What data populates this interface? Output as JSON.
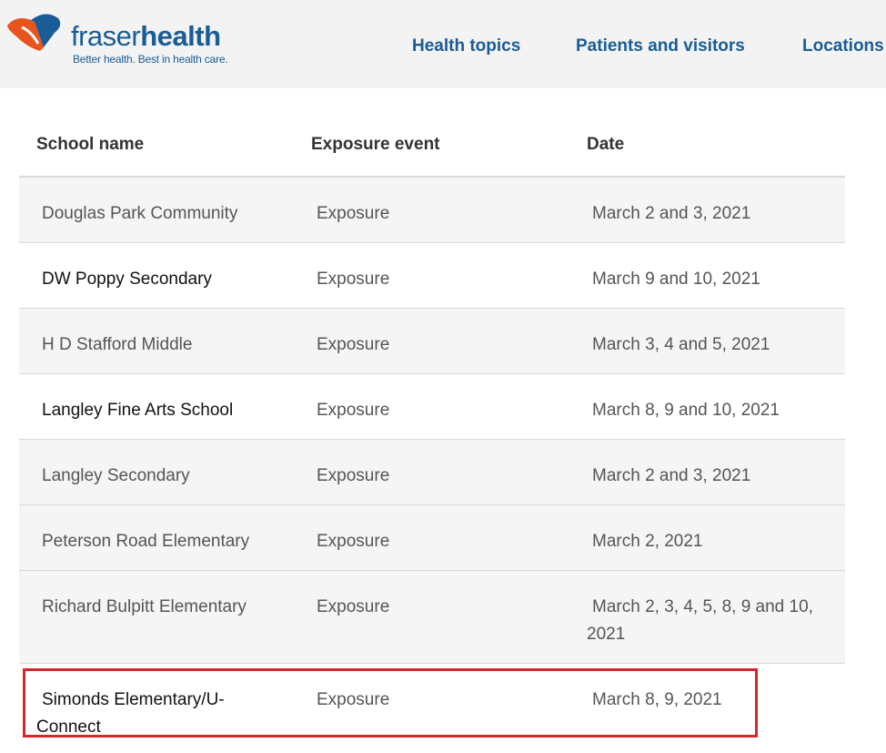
{
  "header": {
    "brand_part1": "fraser",
    "brand_part2": "health",
    "tagline": "Better health. Best in health care.",
    "nav": [
      "Health topics",
      "Patients and visitors",
      "Locations"
    ],
    "colors": {
      "brand_blue": "#1a5c96",
      "logo_orange": "#e8541e",
      "header_bg": "#f3f3f3"
    }
  },
  "table": {
    "headers": [
      "School name",
      "Exposure event",
      "Date"
    ],
    "rows": [
      {
        "school": "Douglas Park Community",
        "event": "Exposure",
        "date": "March 2 and 3, 2021"
      },
      {
        "school": "DW Poppy Secondary",
        "event": "Exposure",
        "date": "March 9 and 10, 2021"
      },
      {
        "school": "H D Stafford Middle",
        "event": "Exposure",
        "date": "March 3, 4 and 5, 2021"
      },
      {
        "school": "Langley Fine Arts School",
        "event": "Exposure",
        "date": "March 8, 9 and 10, 2021"
      },
      {
        "school": "Langley Secondary",
        "event": "Exposure",
        "date": "March 2 and 3, 2021"
      },
      {
        "school": "Peterson Road Elementary",
        "event": "Exposure",
        "date": "March 2, 2021"
      },
      {
        "school": "Richard Bulpitt Elementary",
        "event": "Exposure",
        "date": "March 2, 3, 4, 5, 8, 9 and 10, 2021"
      },
      {
        "school": "Simonds Elementary/U-Connect",
        "event": "Exposure",
        "date": "March 8, 9, 2021"
      }
    ],
    "highlight_color": "#d9262c"
  }
}
